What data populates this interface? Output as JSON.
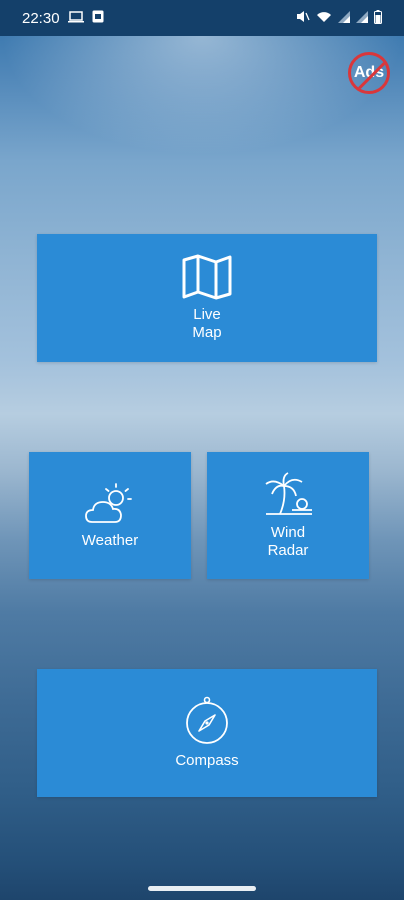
{
  "status_bar": {
    "time": "22:30"
  },
  "ads_button": {
    "label": "Ads"
  },
  "tiles": {
    "live_map": {
      "label": "Live\nMap"
    },
    "weather": {
      "label": "Weather"
    },
    "wind_radar": {
      "label": "Wind\nRadar"
    },
    "compass": {
      "label": "Compass"
    }
  },
  "colors": {
    "tile": "#2b8bd6",
    "status_bar": "#14406a",
    "no_ads_red": "#d9373b"
  }
}
